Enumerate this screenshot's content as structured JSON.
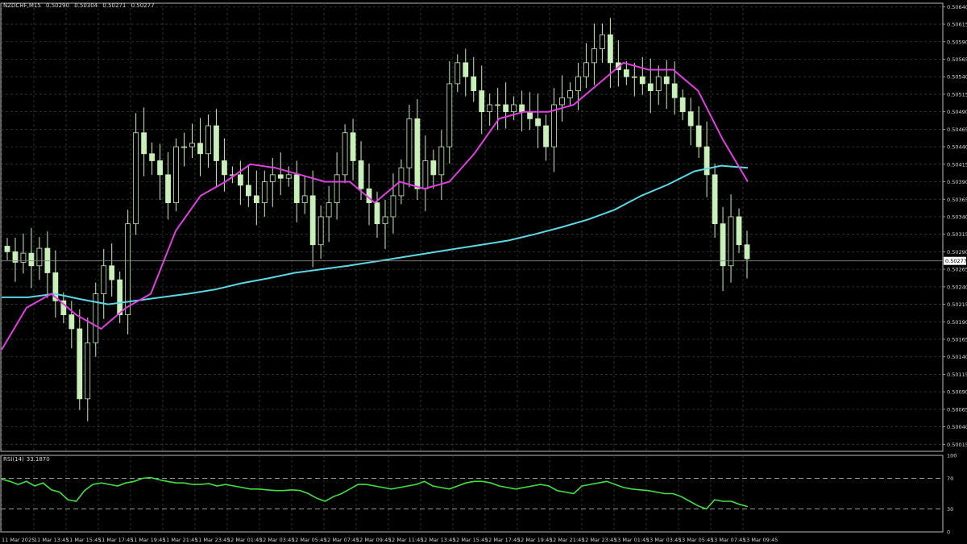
{
  "header": {
    "symbol": "NZDCHF,M15",
    "open": "0.50290",
    "high": "0.50304",
    "low": "0.50271",
    "close": "0.50277"
  },
  "rsi_panel": {
    "label": "RSI(14)",
    "value": "33.1870"
  },
  "colors": {
    "background": "#000000",
    "grid": "#3a3a3a",
    "axis_text": "#d8d8d8",
    "candle": "#c8f0b8",
    "ma_fast": "#e040e0",
    "ma_slow": "#5ad8e6",
    "rsi_line": "#40e040"
  },
  "chart_data": [
    {
      "type": "candlestick",
      "title": "NZDCHF,M15",
      "price_axis_ticks": [
        "0.50640",
        "0.50615",
        "0.50590",
        "0.50565",
        "0.50540",
        "0.50515",
        "0.50490",
        "0.50465",
        "0.50440",
        "0.50415",
        "0.50390",
        "0.50365",
        "0.50340",
        "0.50315",
        "0.50290",
        "0.50265",
        "0.50240",
        "0.50215",
        "0.50190",
        "0.50165",
        "0.50140",
        "0.50115",
        "0.50090",
        "0.50065",
        "0.50040",
        "0.50015"
      ],
      "time_axis_ticks": [
        "11 Mar 2025",
        "11 Mar 13:45",
        "11 Mar 15:45",
        "11 Mar 17:45",
        "11 Mar 19:45",
        "11 Mar 21:45",
        "11 Mar 23:45",
        "12 Mar 01:45",
        "12 Mar 03:45",
        "12 Mar 05:45",
        "12 Mar 07:45",
        "12 Mar 09:45",
        "12 Mar 11:45",
        "12 Mar 13:45",
        "12 Mar 15:45",
        "12 Mar 17:45",
        "12 Mar 19:45",
        "12 Mar 21:45",
        "12 Mar 23:45",
        "13 Mar 01:45",
        "13 Mar 03:45",
        "13 Mar 05:45",
        "13 Mar 07:45",
        "13 Mar 09:45"
      ],
      "ylim": [
        0.50005,
        0.50645
      ],
      "current_price": "0.50277",
      "grid": true,
      "close_series": [
        0.5029,
        0.50275,
        0.50288,
        0.5027,
        0.50295,
        0.5026,
        0.5022,
        0.502,
        0.5018,
        0.5008,
        0.5016,
        0.5023,
        0.5027,
        0.5025,
        0.502,
        0.5033,
        0.5046,
        0.5043,
        0.5042,
        0.504,
        0.5036,
        0.5044,
        0.5044,
        0.50445,
        0.5043,
        0.5047,
        0.5042,
        0.504,
        0.504,
        0.50385,
        0.5037,
        0.5036,
        0.5039,
        0.504,
        0.50395,
        0.504,
        0.5036,
        0.5037,
        0.503,
        0.5034,
        0.5036,
        0.504,
        0.5046,
        0.5042,
        0.5038,
        0.5036,
        0.5033,
        0.5034,
        0.5037,
        0.5041,
        0.5048,
        0.5038,
        0.5042,
        0.504,
        0.5044,
        0.5053,
        0.5056,
        0.5054,
        0.5052,
        0.5049,
        0.505,
        0.505,
        0.5049,
        0.505,
        0.5049,
        0.5048,
        0.5047,
        0.5044,
        0.505,
        0.5051,
        0.5052,
        0.5054,
        0.5056,
        0.5058,
        0.506,
        0.5056,
        0.5055,
        0.5054,
        0.5054,
        0.5053,
        0.5052,
        0.5054,
        0.5053,
        0.5051,
        0.5049,
        0.5047,
        0.5044,
        0.504,
        0.5033,
        0.5027,
        0.5034,
        0.503,
        0.5028
      ],
      "highs_lows_note": "",
      "series": [
        {
          "values": [
            0.50225,
            0.50225,
            0.5023,
            0.50222,
            0.50215,
            0.5022,
            0.50225,
            0.5023,
            0.50236,
            0.50245,
            0.50252,
            0.5026,
            0.50265,
            0.5027,
            0.50276,
            0.50282,
            0.50288,
            0.50294,
            0.503,
            0.50306,
            0.50315,
            0.50325,
            0.50336,
            0.5035,
            0.5037,
            0.50386,
            0.50405,
            0.50413,
            0.5041
          ]
        },
        {
          "values": [
            0.5015,
            0.5021,
            0.5023,
            0.502,
            0.5018,
            0.5021,
            0.5023,
            0.5032,
            0.5037,
            0.5039,
            0.50415,
            0.5041,
            0.504,
            0.5039,
            0.5039,
            0.5036,
            0.5039,
            0.5038,
            0.5039,
            0.5043,
            0.5048,
            0.5049,
            0.5049,
            0.505,
            0.5053,
            0.5056,
            0.5055,
            0.5055,
            0.5052,
            0.5045,
            0.5039
          ]
        }
      ]
    },
    {
      "type": "line",
      "title": "RSI(14) 33.1870",
      "ylim": [
        0,
        100
      ],
      "y_ticks": [
        "100",
        "70",
        "30",
        "0"
      ],
      "levels": [
        70,
        30
      ],
      "values": [
        69,
        66,
        62,
        66,
        60,
        64,
        55,
        52,
        42,
        40,
        54,
        62,
        64,
        62,
        60,
        64,
        66,
        70,
        71,
        68,
        66,
        64,
        64,
        62,
        62,
        63,
        60,
        62,
        60,
        58,
        56,
        56,
        55,
        54,
        54,
        55,
        54,
        50,
        44,
        40,
        46,
        50,
        56,
        62,
        62,
        60,
        58,
        56,
        58,
        60,
        62,
        66,
        60,
        58,
        56,
        60,
        64,
        66,
        66,
        64,
        60,
        58,
        56,
        58,
        60,
        62,
        60,
        54,
        52,
        50,
        60,
        62,
        64,
        66,
        62,
        58,
        56,
        55,
        54,
        52,
        50,
        50,
        46,
        40,
        34,
        30,
        42,
        40,
        40,
        36,
        33
      ]
    }
  ]
}
